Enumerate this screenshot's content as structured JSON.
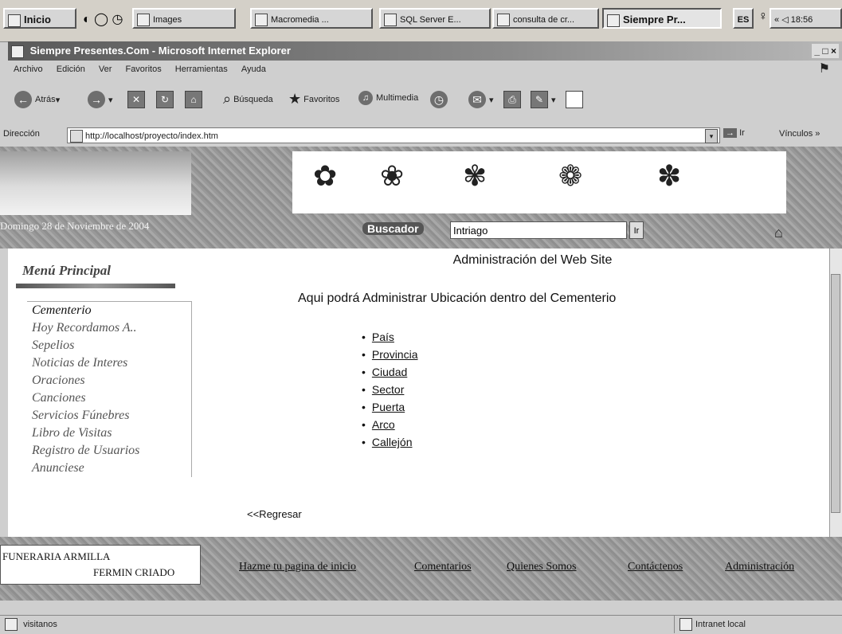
{
  "taskbar": {
    "start": "Inicio",
    "buttons": [
      "Images",
      "Macromedia ...",
      "SQL Server E...",
      "consulta de cr...",
      "Siempre Pr..."
    ],
    "lang": "ES",
    "clock": "18:56",
    "tray_arrows": "«"
  },
  "window": {
    "title": "Siempre Presentes.Com - Microsoft Internet Explorer",
    "controls": "_ □ ×"
  },
  "menubar": [
    "Archivo",
    "Edición",
    "Ver",
    "Favoritos",
    "Herramientas",
    "Ayuda"
  ],
  "toolbar": {
    "back": "Atrás",
    "search": "Búsqueda",
    "favorites": "Favoritos",
    "multimedia": "Multimedia"
  },
  "address": {
    "label": "Dirección",
    "url": "http://localhost/proyecto/index.htm",
    "go": "Ir",
    "links": "Vínculos »"
  },
  "header": {
    "date": "Domingo 28 de Noviembre de 2004",
    "search_label": "Buscador",
    "search_value": "Intriago",
    "search_go": "Ir"
  },
  "sidebar": {
    "title": "Menú Principal",
    "items": [
      "Cementerio",
      "Hoy Recordamos A..",
      "Sepelios",
      "Noticias de Interes",
      "Oraciones",
      "Canciones",
      "Servicios Fúnebres",
      "Libro de Visitas",
      "Registro de Usuarios",
      "Anunciese"
    ]
  },
  "main": {
    "title": "Administración del Web Site",
    "subtitle": "Aqui podrá Administrar Ubicación dentro del Cementerio",
    "links": [
      "País",
      "Provincia",
      "Ciudad",
      "Sector",
      "Puerta",
      "Arco",
      "Callejón"
    ],
    "back": "<<Regresar"
  },
  "footer": {
    "logo_line1": "FUNERARIA ARMILLA",
    "logo_line2": "FERMIN CRIADO",
    "links": [
      "Hazme tu pagina de inicio",
      "Comentarios",
      "Quienes Somos",
      "Contáctenos",
      "Administración"
    ]
  },
  "status": {
    "left": "visitanos",
    "zone": "Intranet local"
  }
}
